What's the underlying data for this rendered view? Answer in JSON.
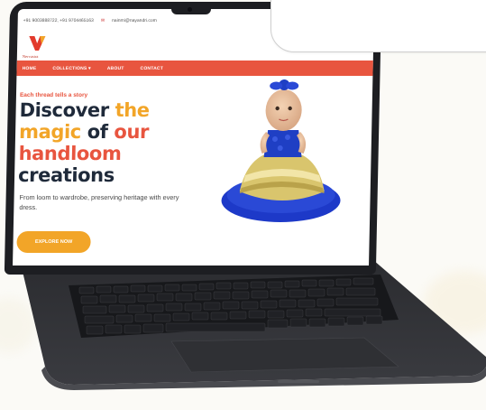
{
  "site": {
    "contact_phones": "+91 9003888722, +91 9704465163",
    "contact_email": "nainmi@nayandri.com",
    "logo_text": "Nervastra",
    "nav": {
      "home": "HOME",
      "collections": "COLLECTIONS ▾",
      "about": "ABOUT",
      "contact": "CONTACT"
    },
    "hero": {
      "tagline": "Each thread tells a story",
      "headline": {
        "w1": "Discover ",
        "w2": "the",
        "w3": "magic",
        "w4": " of ",
        "w5": "our",
        "w6": "handloom",
        "w7": "creations"
      },
      "subtext": "From loom to wardrobe, preserving heritage with every dress.",
      "cta": "EXPLORE NOW"
    }
  },
  "colors": {
    "brand_red": "#e8553f",
    "brand_gold": "#f2a528",
    "heading_dark": "#1f2a3a",
    "dress_blue": "#1f3fc4",
    "dress_gold": "#d8c06a"
  },
  "icons": {
    "mail": "mail-icon",
    "logo": "brand-logo-icon"
  }
}
